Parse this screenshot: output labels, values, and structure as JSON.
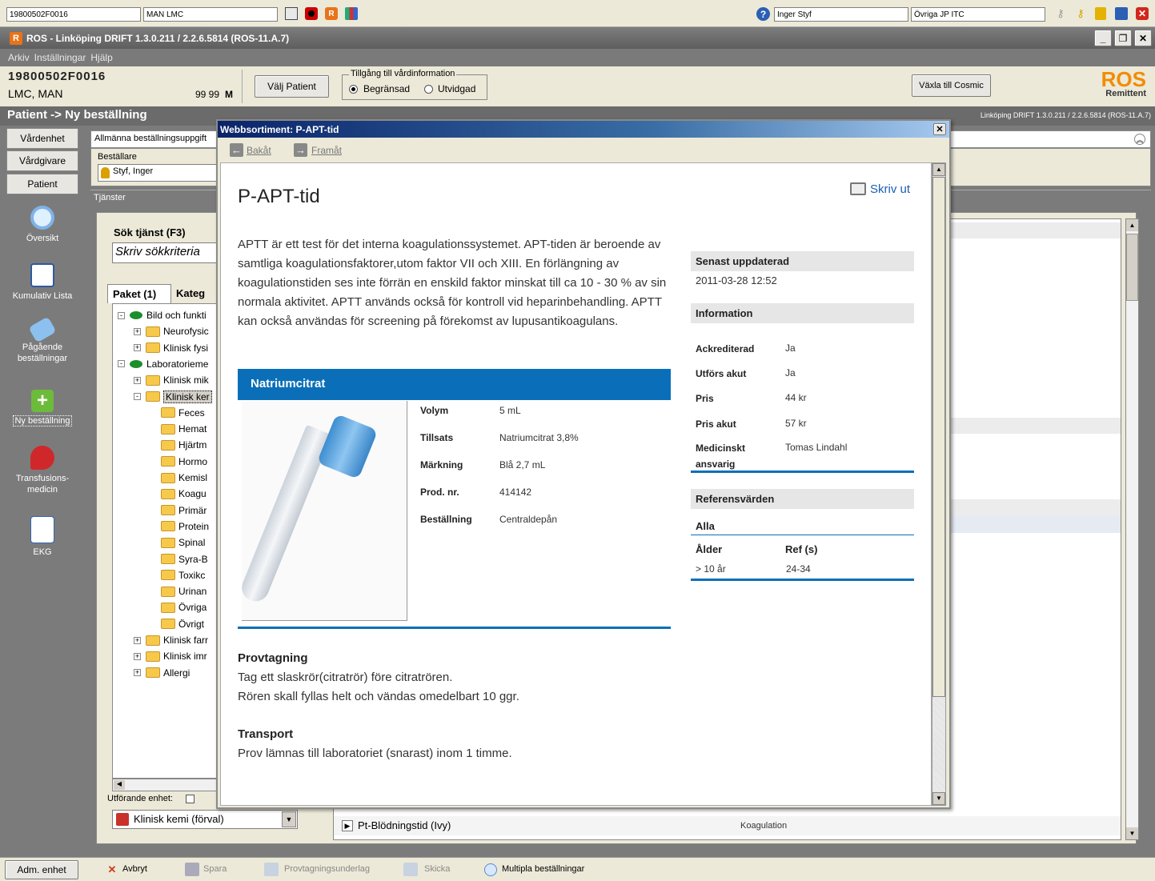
{
  "topbar": {
    "patient_id": "19800502F0016",
    "patient_name": "MAN LMC",
    "user": "Inger Styf",
    "unit": "Övriga JP ITC"
  },
  "titlebar": {
    "title": "ROS - Linköping DRIFT 1.3.0.211 / 2.2.6.5814 (ROS-11.A.7)"
  },
  "menu": [
    "Arkiv",
    "Inställningar",
    "Hjälp"
  ],
  "patient": {
    "id": "19800502F0016",
    "name": "LMC, MAN",
    "age": "99 99",
    "sex": "M",
    "choose_btn": "Välj Patient",
    "access_title": "Tillgång till vårdinformation",
    "access_opt1": "Begränsad",
    "access_opt2": "Utvidgad",
    "cosmic_btn": "Växla till Cosmic",
    "logo_top": "ROS",
    "logo_bottom": "Remittent"
  },
  "breadcrumb": "Patient -> Ny beställning",
  "version": "Linköping DRIFT 1.3.0.211 / 2.2.6.5814 (ROS-11.A.7)",
  "sidebar": {
    "buttons": [
      "Vårdenhet",
      "Vårdgivare",
      "Patient"
    ],
    "items": [
      "Översikt",
      "Kumulativ Lista",
      "Pågående beställningar",
      "Ny beställning",
      "Transfusions-medicin",
      "EKG"
    ],
    "bottom": "Adm. enhet"
  },
  "main": {
    "tab_general": "Allmänna beställningsuppgift",
    "orderer_label": "Beställare",
    "orderer": "Styf, Inger",
    "services_label": "Tjänster",
    "search_label": "Sök tjänst (F3)",
    "search_placeholder": "Skriv sökkriteria",
    "tab_pkg": "Paket (1)",
    "tab_cat": "Kateg",
    "tree": [
      "Bild och funkti",
      "Neurofysic",
      "Klinisk fysi",
      "Laboratorieme",
      "Klinisk mik",
      "Klinisk ker",
      "Feces",
      "Hemat",
      "Hjärtm",
      "Hormo",
      "Kemisl",
      "Koagu",
      "Primär",
      "Protein",
      "Spinal",
      "Syra-B",
      "Toxikc",
      "Urinan",
      "Övriga",
      "Övrigt",
      "Klinisk farr",
      "Klinisk imr",
      "Allergi"
    ],
    "performing_label": "Utförande enhet:",
    "performing_value": "Klinisk kemi (förval)",
    "row_label": "Pt-Blödningstid (Ivy)",
    "row_cat": "Koagulation"
  },
  "statusbar": [
    "Avbryt",
    "Spara",
    "Provtagningsunderlag",
    "Skicka",
    "Multipla beställningar"
  ],
  "dialog": {
    "title": "Webbsortiment: P-APT-tid",
    "back": "Bakåt",
    "forward": "Framåt",
    "print": "Skriv ut",
    "heading": "P-APT-tid",
    "description": "APTT är ett test för det interna koagulationssystemet. APT-tiden är beroende av samtliga koagulationsfaktorer,utom faktor VII och XIII. En förlängning av koagulationstiden ses inte förrän en enskild faktor minskat till ca 10 - 30 % av sin normala aktivitet. APTT används också för kontroll vid heparinbehandling. APTT kan också användas för screening på förekomst av lupusantikoagulans.",
    "tube_header": "Natriumcitrat",
    "tube": [
      {
        "label": "Volym",
        "value": "5 mL"
      },
      {
        "label": "Tillsats",
        "value": "Natriumcitrat 3,8%"
      },
      {
        "label": "Märkning",
        "value": "Blå 2,7 mL"
      },
      {
        "label": "Prod. nr.",
        "value": "414142"
      },
      {
        "label": "Beställning",
        "value": "Centraldepån"
      }
    ],
    "sampling_title": "Provtagning",
    "sampling_lines": [
      "Tag ett slaskrör(citratrör) före citratrören.",
      "Rören skall fyllas helt och vändas omedelbart 10 ggr."
    ],
    "transport_title": "Transport",
    "transport_text": "Prov lämnas till laboratoriet (snarast) inom 1 timme.",
    "updated_label": "Senast uppdaterad",
    "updated_value": "2011-03-28 12:52",
    "info_label": "Information",
    "info": [
      {
        "label": "Ackrediterad",
        "value": "Ja"
      },
      {
        "label": "Utförs akut",
        "value": "Ja"
      },
      {
        "label": "Pris",
        "value": "44 kr"
      },
      {
        "label": "Pris akut",
        "value": "57 kr"
      },
      {
        "label": "Medicinskt ansvarig",
        "value": "Tomas Lindahl"
      }
    ],
    "ref_label": "Referensvärden",
    "ref_group": "Alla",
    "ref_col1": "Ålder",
    "ref_col2": "Ref (s)",
    "ref_age": "> 10 år",
    "ref_value": "24-34"
  }
}
